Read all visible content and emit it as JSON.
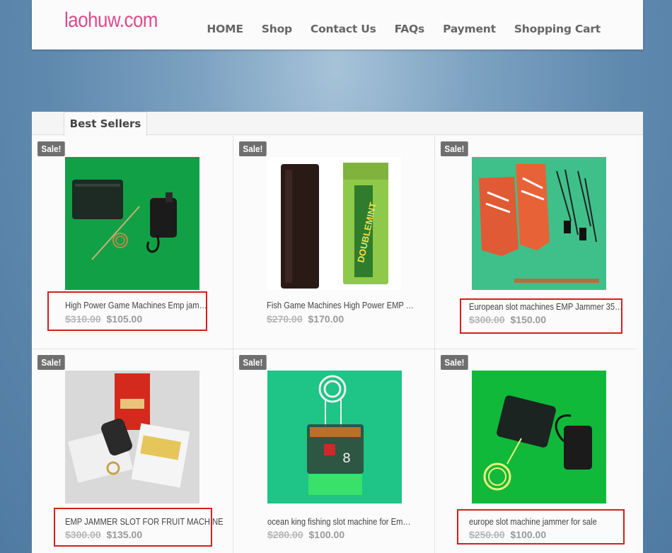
{
  "header": {
    "logo": "laohuw.com",
    "nav": [
      "HOME",
      "Shop",
      "Contact Us",
      "FAQs",
      "Payment",
      "Shopping Cart"
    ]
  },
  "section": {
    "tab_label": "Best Sellers"
  },
  "products": [
    {
      "badge": "Sale!",
      "title": "High Power Game Machines Emp jam…",
      "old_price": "$310.00",
      "price": "$105.00"
    },
    {
      "badge": "Sale!",
      "title": "Fish Game Machines High Power EMP …",
      "old_price": "$270.00",
      "price": "$170.00"
    },
    {
      "badge": "Sale!",
      "title": "European slot machines EMP Jammer 35…",
      "old_price": "$300.00",
      "price": "$150.00"
    },
    {
      "badge": "Sale!",
      "title": "EMP JAMMER SLOT FOR FRUIT MACHINE",
      "old_price": "$300.00",
      "price": "$135.00"
    },
    {
      "badge": "Sale!",
      "title": "ocean king fishing slot machine for Em…",
      "old_price": "$280.00",
      "price": "$100.00"
    },
    {
      "badge": "Sale!",
      "title": "europe slot machine jammer for sale",
      "old_price": "$250.00",
      "price": "$100.00"
    }
  ],
  "colors": {
    "logo": "#e0488a",
    "highlight": "#d81e1e",
    "badge": "#6f6f6f"
  }
}
